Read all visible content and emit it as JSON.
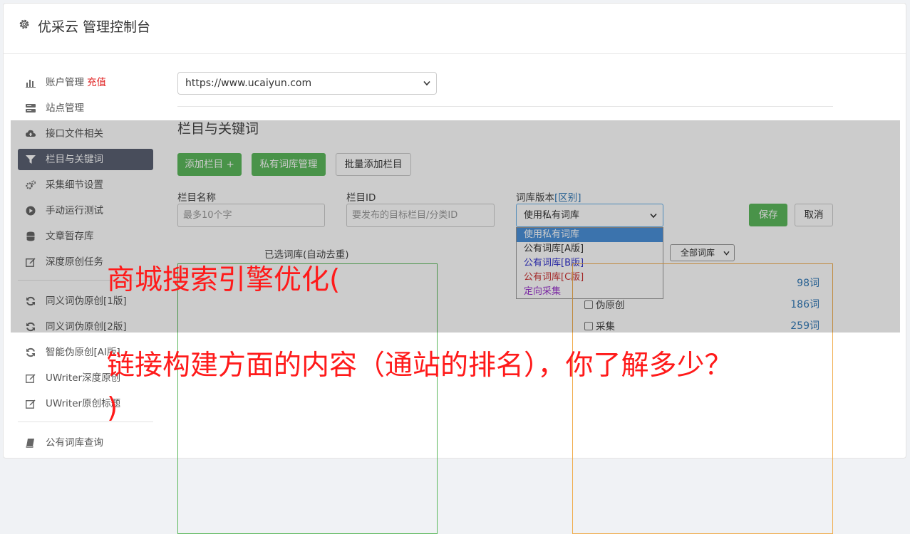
{
  "header": {
    "title": "优采云 管理控制台",
    "icon": "gear-icon"
  },
  "sidebar": {
    "items": [
      {
        "label": "账户管理",
        "badge": "充值",
        "icon": "bar-chart-icon"
      },
      {
        "label": "站点管理",
        "icon": "server-icon"
      },
      {
        "label": "接口文件相关",
        "icon": "cloud-upload-icon"
      },
      {
        "label": "栏目与关键词",
        "icon": "filter-icon",
        "active": true
      },
      {
        "label": "采集细节设置",
        "icon": "cogs-icon"
      },
      {
        "label": "手动运行测试",
        "icon": "play-circle-icon"
      },
      {
        "label": "文章暂存库",
        "icon": "database-icon"
      },
      {
        "label": "深度原创任务",
        "icon": "edit-icon"
      }
    ],
    "items2": [
      {
        "label": "同义词伪原创[1版]",
        "icon": "refresh-icon"
      },
      {
        "label": "同义词伪原创[2版]",
        "icon": "refresh-icon"
      },
      {
        "label": "智能伪原创[AI版]",
        "icon": "refresh-icon"
      },
      {
        "label": "UWriter深度原创",
        "icon": "edit-icon"
      },
      {
        "label": "UWriter原创标题",
        "icon": "edit-icon"
      }
    ],
    "items3": [
      {
        "label": "公有词库查询",
        "icon": "book-icon"
      }
    ]
  },
  "main": {
    "site_select": "https://www.ucaiyun.com",
    "section_title": "栏目与关键词",
    "buttons": {
      "add_column": "添加栏目 +",
      "private_lib": "私有词库管理",
      "batch_add": "批量添加栏目",
      "save": "保存",
      "cancel": "取消"
    },
    "form": {
      "column_name_label": "栏目名称",
      "column_name_placeholder": "最多10个字",
      "column_id_label": "栏目ID",
      "column_id_placeholder": "要发布的目标栏目/分类ID",
      "version_label": "词库版本",
      "version_link": "[区别]",
      "version_selected": "使用私有词库",
      "version_options": [
        {
          "label": "使用私有词库",
          "color": "#ffffff",
          "bg": "#4a90d9"
        },
        {
          "label": "公有词库[A版]",
          "color": "#333333"
        },
        {
          "label": "公有词库[B版]",
          "color": "#3333cc"
        },
        {
          "label": "公有词库[C版]",
          "color": "#cc3333"
        },
        {
          "label": "定向采集",
          "color": "#9933cc"
        }
      ]
    },
    "selected_lib_title": "已选词库(自动去重)",
    "all_libs_select": "全部词库",
    "lib_rows": [
      {
        "label": "",
        "count": "98词"
      },
      {
        "label": "伪原创",
        "count": "186词"
      },
      {
        "label": "采集",
        "count": "259词"
      }
    ]
  },
  "watermark": {
    "line1": "商城搜索引擎优化(",
    "line2": "链接构建方面的内容（通站的排名），你了解多少？",
    "line3": ")"
  }
}
